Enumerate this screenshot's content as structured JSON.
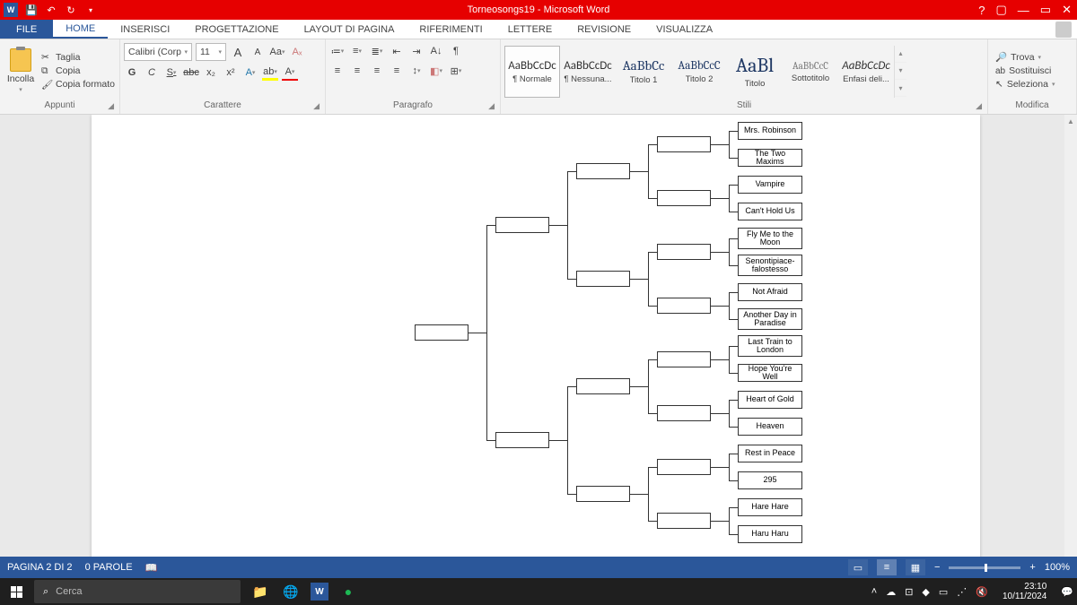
{
  "titlebar": {
    "doc_title": "Torneosongs19 - Microsoft Word",
    "help": "?",
    "ribbon_opts": "▢",
    "minimize": "—",
    "restore": "▭",
    "close": "✕"
  },
  "tabs": {
    "file": "FILE",
    "home": "HOME",
    "inserisci": "INSERISCI",
    "progettazione": "PROGETTAZIONE",
    "layout": "LAYOUT DI PAGINA",
    "riferimenti": "RIFERIMENTI",
    "lettere": "LETTERE",
    "revisione": "REVISIONE",
    "visualizza": "VISUALIZZA"
  },
  "clipboard": {
    "incolla": "Incolla",
    "taglia": "Taglia",
    "copia": "Copia",
    "copia_formato": "Copia formato",
    "label": "Appunti"
  },
  "font": {
    "name": "Calibri (Corp",
    "size": "11",
    "label": "Carattere",
    "grow": "A",
    "shrink": "A",
    "case": "Aa",
    "bold": "G",
    "italic": "C",
    "underline": "S",
    "strike": "abc",
    "sub": "x₂",
    "sup": "x²",
    "effects": "A",
    "highlight": "ab",
    "color": "A"
  },
  "paragraph": {
    "label": "Paragrafo"
  },
  "styles": {
    "label": "Stili",
    "sample": "AaBbCcDc",
    "sample_h": "AaBbCc",
    "sample_h2": "AaBbCcC",
    "sample_title": "AaBl",
    "sample_sub": "AaBbCcC",
    "s1": "¶ Normale",
    "s2": "¶ Nessuna...",
    "s3": "Titolo 1",
    "s4": "Titolo 2",
    "s5": "Titolo",
    "s6": "Sottotitolo",
    "s7": "Enfasi deli..."
  },
  "editing": {
    "trova": "Trova",
    "sostituisci": "Sostituisci",
    "seleziona": "Seleziona",
    "label": "Modifica"
  },
  "bracket": {
    "entries": [
      "Mrs. Robinson",
      "The Two Maxims",
      "Vampire",
      "Can't Hold Us",
      "Fly Me to the Moon",
      "Senontipiace-falostesso",
      "Not Afraid",
      "Another Day in Paradise",
      "Last Train to London",
      "Hope You're Well",
      "Heart of Gold",
      "Heaven",
      "Rest in Peace",
      "295",
      "Hare Hare",
      "Haru Haru"
    ]
  },
  "status": {
    "page": "PAGINA 2 DI 2",
    "words": "0 PAROLE",
    "zoom": "100%"
  },
  "taskbar": {
    "search": "Cerca",
    "time": "23:10",
    "date": "10/11/2024"
  }
}
